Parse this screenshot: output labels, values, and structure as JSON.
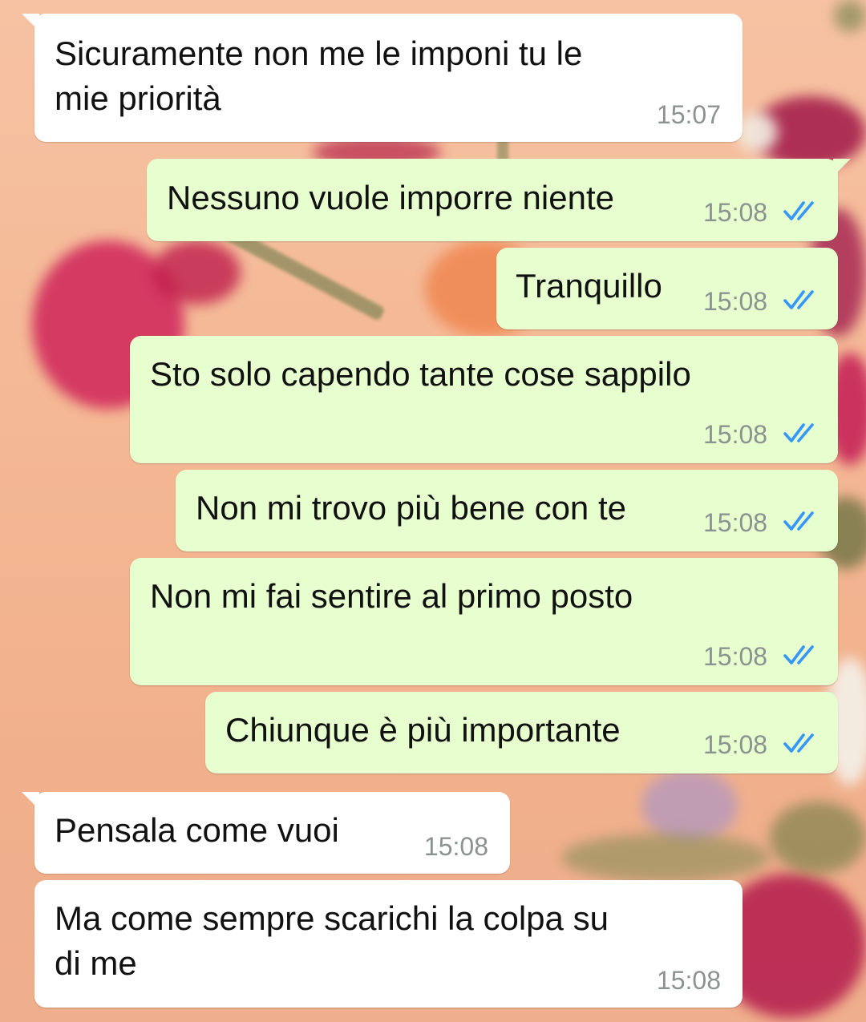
{
  "chat": {
    "colors": {
      "incoming_bubble": "#ffffff",
      "outgoing_bubble": "#e7fecf",
      "read_ticks": "#3497f9",
      "timestamp": "#8b9390"
    },
    "messages": [
      {
        "direction": "incoming",
        "lines": [
          "Sicuramente non me le imponi tu le",
          "mie priorità"
        ],
        "time": "15:07"
      },
      {
        "direction": "outgoing",
        "lines": [
          "Nessuno vuole imporre niente"
        ],
        "time": "15:08",
        "status": "read",
        "status_icon": "double-check-icon"
      },
      {
        "direction": "outgoing",
        "lines": [
          "Tranquillo"
        ],
        "time": "15:08",
        "status": "read",
        "status_icon": "double-check-icon"
      },
      {
        "direction": "outgoing",
        "lines": [
          "Sto solo capendo tante cose sappilo"
        ],
        "time": "15:08",
        "status": "read",
        "status_icon": "double-check-icon"
      },
      {
        "direction": "outgoing",
        "lines": [
          "Non mi trovo più bene con te"
        ],
        "time": "15:08",
        "status": "read",
        "status_icon": "double-check-icon"
      },
      {
        "direction": "outgoing",
        "lines": [
          "Non mi fai sentire al primo posto"
        ],
        "time": "15:08",
        "status": "read",
        "status_icon": "double-check-icon"
      },
      {
        "direction": "outgoing",
        "lines": [
          "Chiunque è più importante"
        ],
        "time": "15:08",
        "status": "read",
        "status_icon": "double-check-icon"
      },
      {
        "direction": "incoming",
        "lines": [
          "Pensala come vuoi"
        ],
        "time": "15:08"
      },
      {
        "direction": "incoming",
        "lines": [
          "Ma come sempre scarichi la colpa su",
          "di me"
        ],
        "time": "15:08"
      }
    ]
  }
}
